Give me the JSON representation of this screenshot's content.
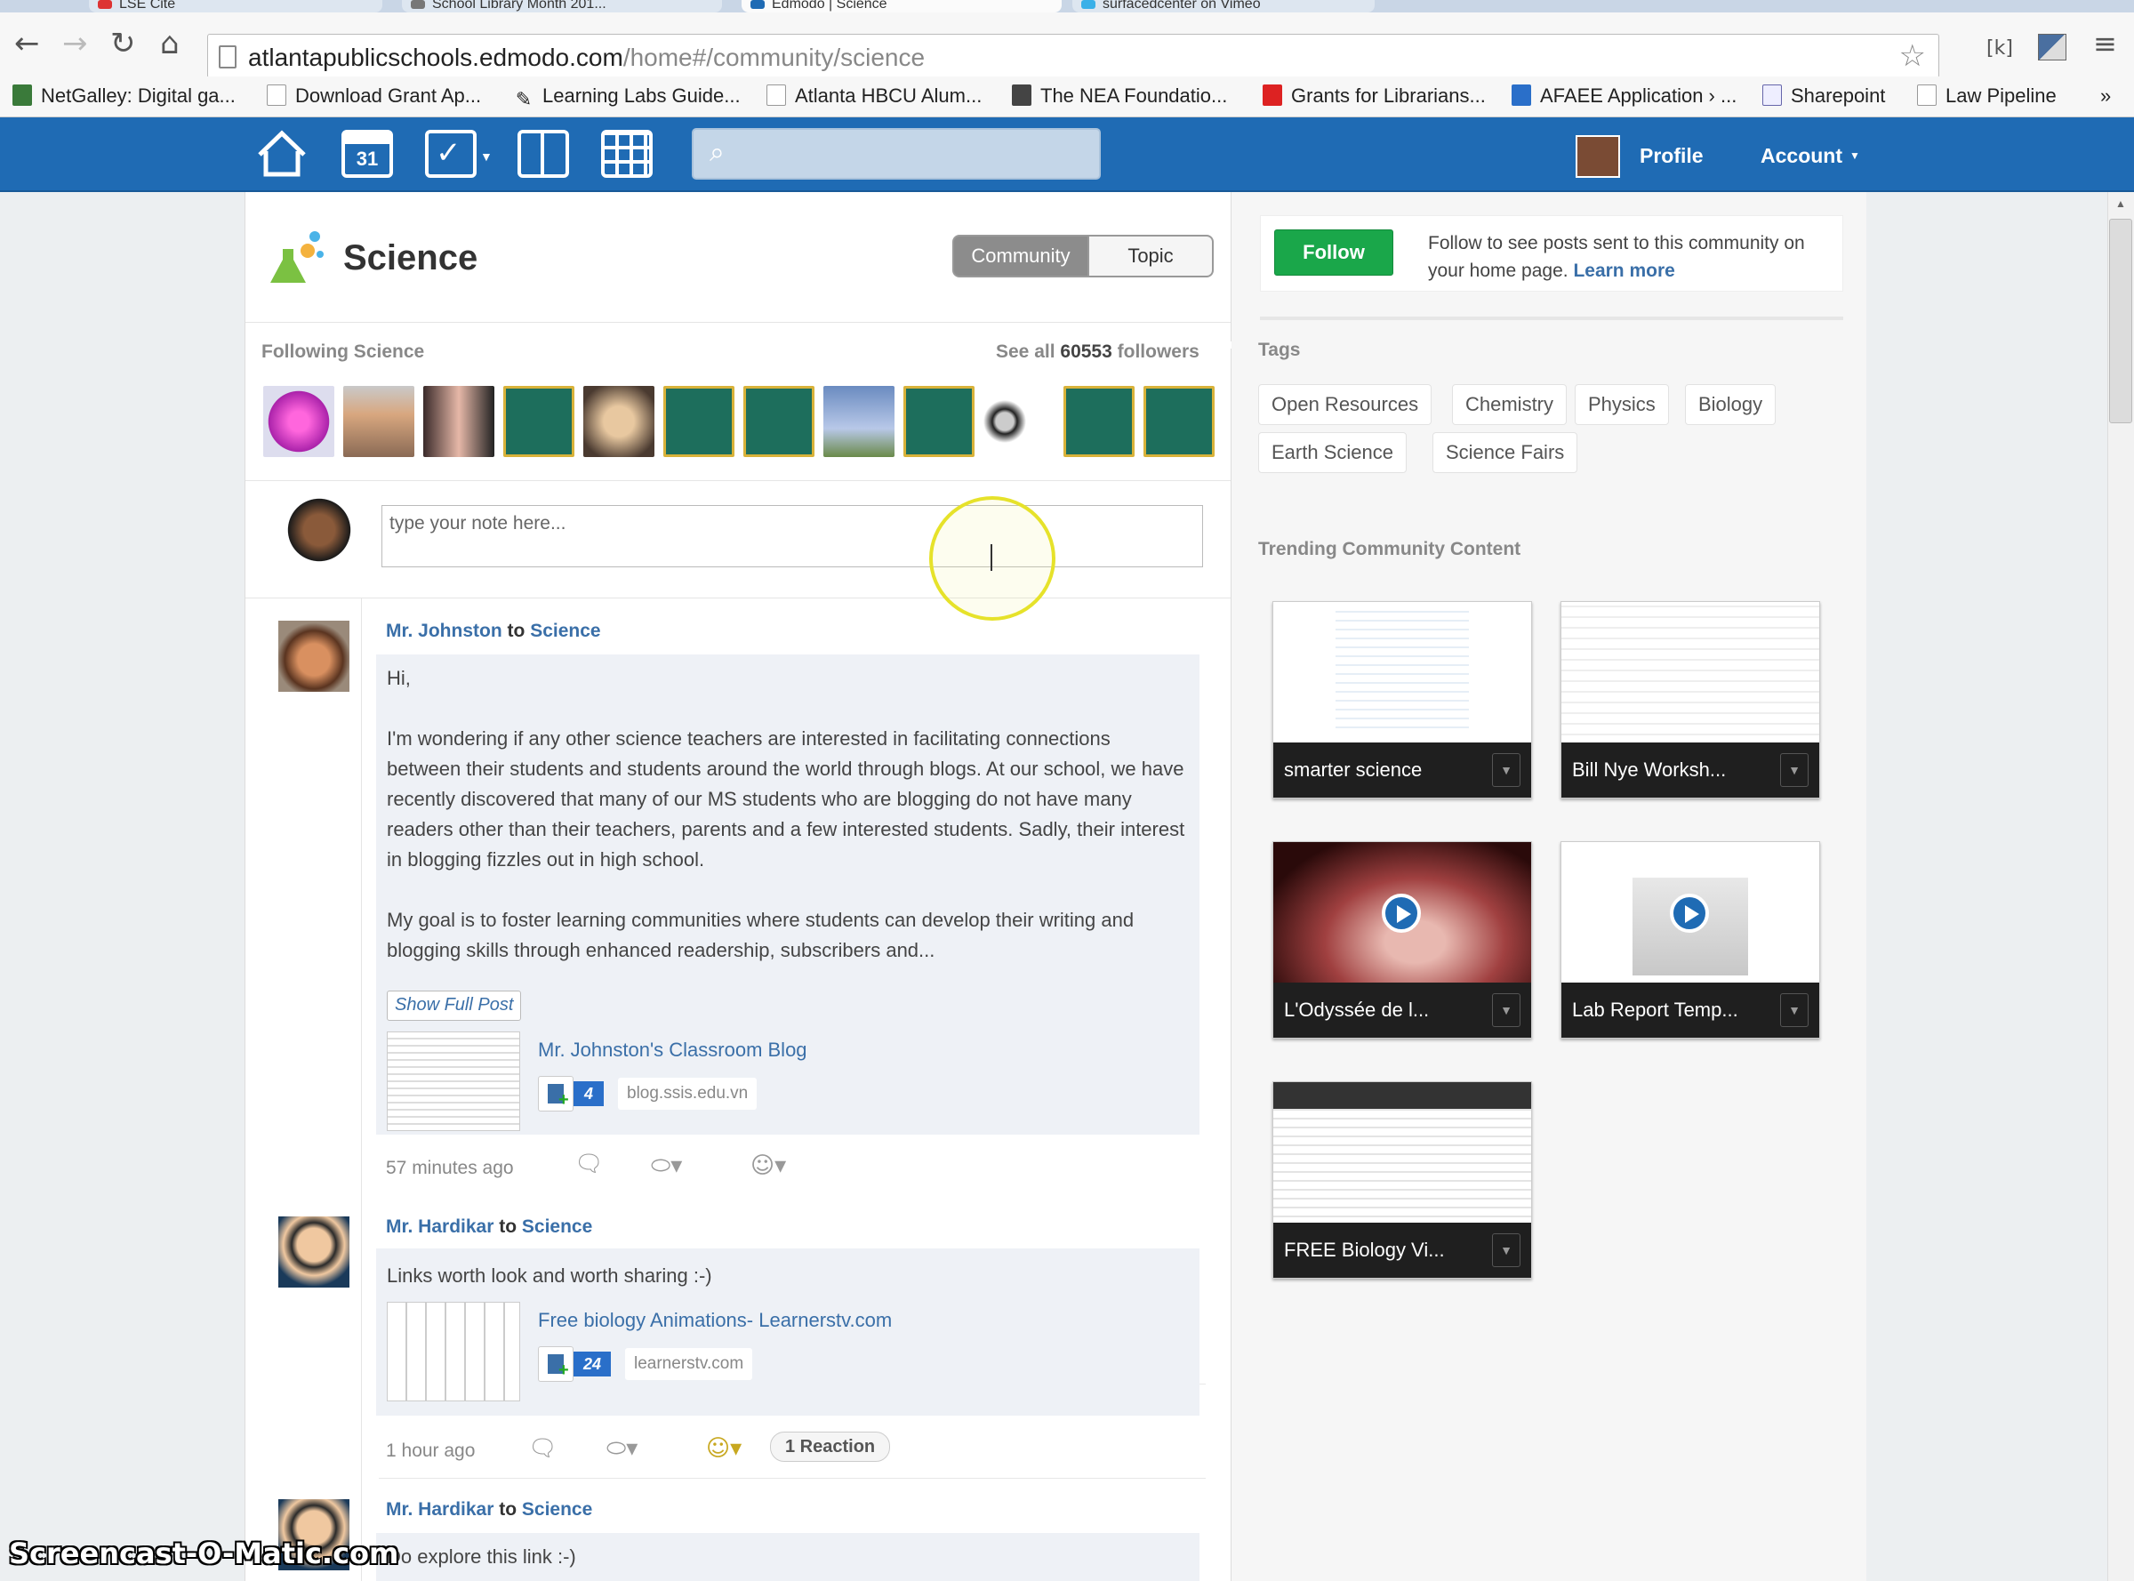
{
  "browser": {
    "tabs": [
      {
        "label": "LSE Cite"
      },
      {
        "label": "School Library Month 201..."
      },
      {
        "label": "Edmodo | Science"
      },
      {
        "label": "surfacedcenter on Vimeo"
      }
    ],
    "url_host": "atlantapublicschools.edmodo.com",
    "url_path": "/home#/community/science",
    "bookmarks": [
      "NetGalley: Digital ga...",
      "Download Grant Ap...",
      "Learning Labs Guide...",
      "Atlanta HBCU Alum...",
      "The NEA Foundatio...",
      "Grants for Librarians...",
      "AFAEE Application › ...",
      "Sharepoint",
      "Law Pipeline"
    ],
    "more_bookmarks": "»"
  },
  "topnav": {
    "profile": "Profile",
    "account": "Account",
    "calendar_day": "31"
  },
  "community": {
    "title": "Science",
    "seg_community": "Community",
    "seg_topic": "Topic",
    "following_label": "Following Science",
    "see_all_prefix": "See all ",
    "followers_count": "60553",
    "followers_suffix": " followers"
  },
  "composer": {
    "placeholder": "type your note here..."
  },
  "posts": [
    {
      "author": "Mr. Johnston",
      "to": "to",
      "group": "Science",
      "greeting": "Hi,",
      "p1": "I'm wondering if any other science teachers are interested in facilitating connections between their students and students around the world through blogs. At our school, we have recently discovered that many of our MS students who are blogging do not have many readers other than their teachers, parents and a few interested students. Sadly, their interest in blogging fizzles out in high school.",
      "p2": "My goal is to foster learning communities where students can develop their writing and blogging skills through enhanced readership, subscribers and...",
      "show_full": "Show Full Post",
      "link_title": "Mr. Johnston's Classroom Blog",
      "link_count": "4",
      "link_domain": "blog.ssis.edu.vn",
      "time": "57 minutes ago"
    },
    {
      "author": "Mr. Hardikar",
      "to": "to",
      "group": "Science",
      "text": "Links worth look and worth sharing :-)",
      "link_title": "Free biology Animations- Learnerstv.com",
      "link_count": "24",
      "link_domain": "learnerstv.com",
      "time": "1 hour ago",
      "reaction": "1 Reaction"
    },
    {
      "author": "Mr. Hardikar",
      "to": "to",
      "group": "Science",
      "text": "Do explore this link :-)"
    }
  ],
  "sidebar": {
    "follow_button": "Follow",
    "follow_text": "Follow to see posts sent to this community on your home page. ",
    "learn_more": "Learn more",
    "tags_label": "Tags",
    "tags": [
      "Open Resources",
      "Chemistry",
      "Physics",
      "Biology",
      "Earth Science",
      "Science Fairs"
    ],
    "trending_label": "Trending Community Content",
    "cards": [
      {
        "caption": "smarter science"
      },
      {
        "caption": "Bill Nye Worksh..."
      },
      {
        "caption": "L'Odyssée de l..."
      },
      {
        "caption": "Lab Report Temp..."
      },
      {
        "caption": "FREE Biology Vi..."
      }
    ]
  },
  "watermark": "Screencast-O-Matic.com",
  "colors": {
    "edmodo_blue": "#1f6bb4",
    "follow_green": "#1aa74a",
    "link_blue": "#3a6fa8",
    "cursor_highlight": "#e6e22a"
  }
}
